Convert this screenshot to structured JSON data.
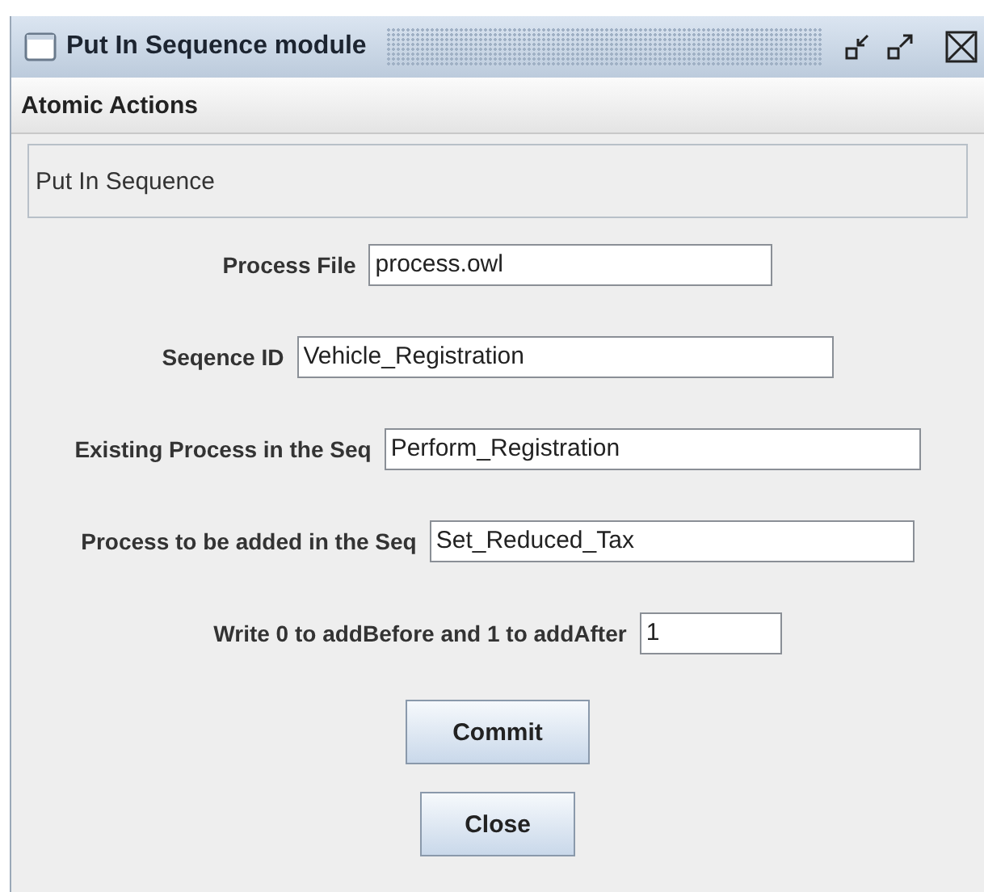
{
  "window": {
    "title": "Put In Sequence module"
  },
  "menu": [
    "Atomic Actions"
  ],
  "panel": {
    "title": "Put In Sequence"
  },
  "fields": [
    {
      "label": "Process File",
      "value": "process.owl"
    },
    {
      "label": "Seqence ID",
      "value": "Vehicle_Registration"
    },
    {
      "label": "Existing Process in the Seq",
      "value": "Perform_Registration"
    },
    {
      "label": "Process to be added in the Seq",
      "value": "Set_Reduced_Tax"
    },
    {
      "label": "Write 0 to addBefore and 1 to addAfter",
      "value": "1"
    }
  ],
  "buttons": [
    "Commit",
    "Close"
  ]
}
